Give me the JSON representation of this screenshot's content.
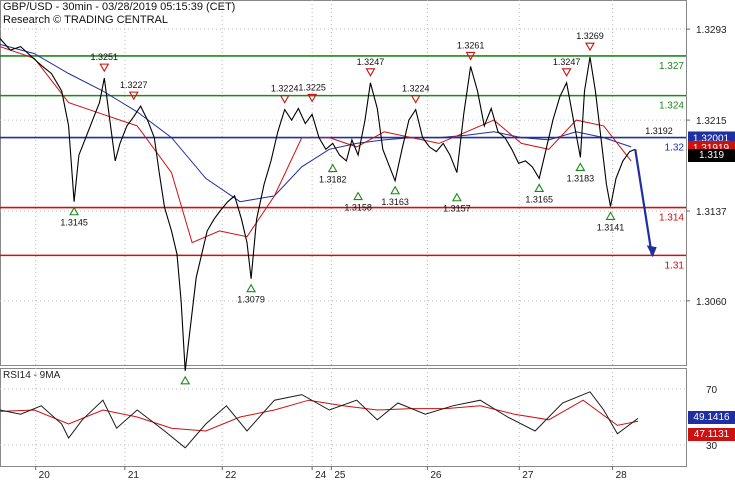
{
  "header": {
    "title": "GBP/USD - 30min - 03/28/2019 05:15:39 (CET)",
    "source": "Research © TRADING CENTRAL"
  },
  "rsi_panel": {
    "label": "RSI14 - 9MA",
    "axis_ticks": [
      70,
      30
    ],
    "rsi_value": "49.1416",
    "ma_value": "47.1131"
  },
  "price_axis": {
    "ticks": [
      "1.3293",
      "1.3215",
      "1.3137",
      "1.3060"
    ],
    "current_price": "1.319",
    "badges": [
      {
        "text": "1.32001",
        "bg": "#1f2fa0",
        "fg": "#ffffff",
        "price": 1.32001
      },
      {
        "text": "1.31919",
        "bg": "#cc1111",
        "fg": "#ffffff",
        "price": 1.3192
      }
    ]
  },
  "x_axis": {
    "labels": [
      "20",
      "21",
      "22",
      "24",
      "25",
      "26",
      "27",
      "28"
    ],
    "label_frac": [
      0.052,
      0.182,
      0.324,
      0.455,
      0.483,
      0.623,
      0.757,
      0.893
    ]
  },
  "colors": {
    "resistance": "#1a8a1a",
    "pivot": "#1f2fa0",
    "support": "#cc1111",
    "price": "#000000",
    "ma_fast": "#cc1111",
    "ma_slow": "#1f2fa0",
    "forecast": "#1f2fa0"
  },
  "chart_data": {
    "type": "line",
    "title": "GBP/USD - 30min - 03/28/2019 05:15:39 (CET)",
    "ylim": [
      1.3005,
      1.3318
    ],
    "levels": [
      {
        "label": "1.327",
        "value": 1.327,
        "kind": "resistance"
      },
      {
        "label": "1.324",
        "value": 1.3236,
        "kind": "resistance"
      },
      {
        "label": "1.32",
        "value": 1.32,
        "kind": "pivot"
      },
      {
        "label": "1.314",
        "value": 1.314,
        "kind": "support"
      },
      {
        "label": "1.31",
        "value": 1.3099,
        "kind": "support"
      }
    ],
    "price_points": [
      [
        0.0,
        1.3285
      ],
      [
        0.015,
        1.3275
      ],
      [
        0.03,
        1.3278
      ],
      [
        0.045,
        1.327
      ],
      [
        0.06,
        1.3262
      ],
      [
        0.075,
        1.3255
      ],
      [
        0.09,
        1.324
      ],
      [
        0.1,
        1.321
      ],
      [
        0.108,
        1.3145
      ],
      [
        0.115,
        1.3185
      ],
      [
        0.125,
        1.32
      ],
      [
        0.135,
        1.3215
      ],
      [
        0.145,
        1.323
      ],
      [
        0.152,
        1.3251
      ],
      [
        0.16,
        1.3215
      ],
      [
        0.168,
        1.318
      ],
      [
        0.175,
        1.3195
      ],
      [
        0.185,
        1.321
      ],
      [
        0.195,
        1.3218
      ],
      [
        0.205,
        1.3227
      ],
      [
        0.215,
        1.3215
      ],
      [
        0.225,
        1.32
      ],
      [
        0.232,
        1.317
      ],
      [
        0.24,
        1.314
      ],
      [
        0.25,
        1.312
      ],
      [
        0.258,
        1.31
      ],
      [
        0.264,
        1.306
      ],
      [
        0.27,
        1.3
      ],
      [
        0.278,
        1.304
      ],
      [
        0.286,
        1.308
      ],
      [
        0.294,
        1.31
      ],
      [
        0.302,
        1.312
      ],
      [
        0.312,
        1.313
      ],
      [
        0.322,
        1.3138
      ],
      [
        0.332,
        1.3145
      ],
      [
        0.342,
        1.315
      ],
      [
        0.352,
        1.313
      ],
      [
        0.36,
        1.311
      ],
      [
        0.366,
        1.3079
      ],
      [
        0.374,
        1.313
      ],
      [
        0.385,
        1.316
      ],
      [
        0.395,
        1.318
      ],
      [
        0.405,
        1.3205
      ],
      [
        0.415,
        1.3224
      ],
      [
        0.425,
        1.3215
      ],
      [
        0.435,
        1.3225
      ],
      [
        0.445,
        1.3212
      ],
      [
        0.455,
        1.322
      ],
      [
        0.465,
        1.32
      ],
      [
        0.475,
        1.319
      ],
      [
        0.485,
        1.3195
      ],
      [
        0.495,
        1.3185
      ],
      [
        0.505,
        1.318
      ],
      [
        0.513,
        1.3198
      ],
      [
        0.522,
        1.3185
      ],
      [
        0.532,
        1.3215
      ],
      [
        0.54,
        1.3247
      ],
      [
        0.55,
        1.3225
      ],
      [
        0.558,
        1.319
      ],
      [
        0.568,
        1.3175
      ],
      [
        0.576,
        1.3163
      ],
      [
        0.586,
        1.319
      ],
      [
        0.596,
        1.3215
      ],
      [
        0.606,
        1.3224
      ],
      [
        0.616,
        1.32
      ],
      [
        0.626,
        1.3192
      ],
      [
        0.636,
        1.3188
      ],
      [
        0.646,
        1.3195
      ],
      [
        0.656,
        1.3185
      ],
      [
        0.666,
        1.317
      ],
      [
        0.676,
        1.322
      ],
      [
        0.686,
        1.3261
      ],
      [
        0.696,
        1.324
      ],
      [
        0.706,
        1.321
      ],
      [
        0.716,
        1.3225
      ],
      [
        0.726,
        1.3205
      ],
      [
        0.736,
        1.32
      ],
      [
        0.746,
        1.319
      ],
      [
        0.756,
        1.3178
      ],
      [
        0.766,
        1.318
      ],
      [
        0.776,
        1.3175
      ],
      [
        0.786,
        1.3165
      ],
      [
        0.796,
        1.319
      ],
      [
        0.806,
        1.3215
      ],
      [
        0.816,
        1.3235
      ],
      [
        0.826,
        1.3247
      ],
      [
        0.836,
        1.3215
      ],
      [
        0.846,
        1.3183
      ],
      [
        0.852,
        1.324
      ],
      [
        0.86,
        1.3269
      ],
      [
        0.868,
        1.324
      ],
      [
        0.876,
        1.32
      ],
      [
        0.884,
        1.316
      ],
      [
        0.89,
        1.3141
      ],
      [
        0.898,
        1.3165
      ],
      [
        0.908,
        1.318
      ],
      [
        0.918,
        1.3188
      ],
      [
        0.926,
        1.319
      ]
    ],
    "ma_fast_points": [
      [
        0.0,
        1.3278
      ],
      [
        0.05,
        1.3268
      ],
      [
        0.1,
        1.323
      ],
      [
        0.15,
        1.322
      ],
      [
        0.2,
        1.321
      ],
      [
        0.25,
        1.317
      ],
      [
        0.28,
        1.311
      ],
      [
        0.32,
        1.312
      ],
      [
        0.36,
        1.3115
      ],
      [
        0.4,
        1.315
      ],
      [
        0.44,
        1.32
      ],
      [
        0.48,
        1.32
      ],
      [
        0.52,
        1.3192
      ],
      [
        0.56,
        1.3205
      ],
      [
        0.6,
        1.32
      ],
      [
        0.64,
        1.3195
      ],
      [
        0.68,
        1.3205
      ],
      [
        0.72,
        1.3215
      ],
      [
        0.76,
        1.3195
      ],
      [
        0.8,
        1.319
      ],
      [
        0.84,
        1.3215
      ],
      [
        0.88,
        1.321
      ],
      [
        0.92,
        1.318
      ]
    ],
    "ma_slow_points": [
      [
        0.0,
        1.328
      ],
      [
        0.05,
        1.3272
      ],
      [
        0.1,
        1.3255
      ],
      [
        0.15,
        1.324
      ],
      [
        0.2,
        1.3222
      ],
      [
        0.25,
        1.32
      ],
      [
        0.3,
        1.3165
      ],
      [
        0.35,
        1.3145
      ],
      [
        0.4,
        1.315
      ],
      [
        0.44,
        1.3175
      ],
      [
        0.48,
        1.319
      ],
      [
        0.52,
        1.3195
      ],
      [
        0.56,
        1.3198
      ],
      [
        0.6,
        1.32
      ],
      [
        0.64,
        1.32
      ],
      [
        0.68,
        1.3202
      ],
      [
        0.72,
        1.3205
      ],
      [
        0.76,
        1.32
      ],
      [
        0.8,
        1.3198
      ],
      [
        0.84,
        1.3205
      ],
      [
        0.88,
        1.32
      ],
      [
        0.92,
        1.3192
      ]
    ],
    "forecast": [
      [
        0.926,
        1.319
      ],
      [
        0.95,
        1.31
      ]
    ],
    "annotations": [
      {
        "x": 0.108,
        "y": 1.3145,
        "label": "1.3145",
        "kind": "low"
      },
      {
        "x": 0.152,
        "y": 1.3251,
        "label": "1.3251",
        "kind": "high"
      },
      {
        "x": 0.195,
        "y": 1.3227,
        "label": "1.3227",
        "kind": "high"
      },
      {
        "x": 0.27,
        "y": 1.3,
        "label": "",
        "kind": "low"
      },
      {
        "x": 0.366,
        "y": 1.3079,
        "label": "1.3079",
        "kind": "low"
      },
      {
        "x": 0.415,
        "y": 1.3224,
        "label": "1.3224",
        "kind": "high"
      },
      {
        "x": 0.455,
        "y": 1.3225,
        "label": "1.3225",
        "kind": "high"
      },
      {
        "x": 0.485,
        "y": 1.3182,
        "label": "1.3182",
        "kind": "low"
      },
      {
        "x": 0.522,
        "y": 1.3158,
        "label": "1.3158",
        "kind": "low"
      },
      {
        "x": 0.54,
        "y": 1.3247,
        "label": "1.3247",
        "kind": "high"
      },
      {
        "x": 0.576,
        "y": 1.3163,
        "label": "1.3163",
        "kind": "low"
      },
      {
        "x": 0.606,
        "y": 1.3224,
        "label": "1.3224",
        "kind": "high"
      },
      {
        "x": 0.666,
        "y": 1.3157,
        "label": "1.3157",
        "kind": "low"
      },
      {
        "x": 0.686,
        "y": 1.3261,
        "label": "1.3261",
        "kind": "high"
      },
      {
        "x": 0.786,
        "y": 1.3165,
        "label": "1.3165",
        "kind": "low"
      },
      {
        "x": 0.826,
        "y": 1.3247,
        "label": "1.3247",
        "kind": "high"
      },
      {
        "x": 0.846,
        "y": 1.3183,
        "label": "1.3183",
        "kind": "low"
      },
      {
        "x": 0.86,
        "y": 1.3269,
        "label": "1.3269",
        "kind": "high"
      },
      {
        "x": 0.89,
        "y": 1.3141,
        "label": "1.3141",
        "kind": "low"
      },
      {
        "x": 0.926,
        "y": 1.3192,
        "label": "1.3192",
        "kind": "note"
      }
    ],
    "rsi": {
      "ylim": [
        15,
        85
      ],
      "rsi_points": [
        [
          0.0,
          55
        ],
        [
          0.03,
          52
        ],
        [
          0.06,
          58
        ],
        [
          0.09,
          45
        ],
        [
          0.1,
          35
        ],
        [
          0.12,
          48
        ],
        [
          0.15,
          62
        ],
        [
          0.17,
          42
        ],
        [
          0.2,
          55
        ],
        [
          0.24,
          40
        ],
        [
          0.27,
          28
        ],
        [
          0.3,
          45
        ],
        [
          0.33,
          58
        ],
        [
          0.36,
          40
        ],
        [
          0.4,
          62
        ],
        [
          0.44,
          66
        ],
        [
          0.48,
          55
        ],
        [
          0.52,
          62
        ],
        [
          0.55,
          48
        ],
        [
          0.58,
          60
        ],
        [
          0.62,
          52
        ],
        [
          0.66,
          58
        ],
        [
          0.7,
          62
        ],
        [
          0.74,
          50
        ],
        [
          0.78,
          40
        ],
        [
          0.82,
          60
        ],
        [
          0.86,
          68
        ],
        [
          0.88,
          55
        ],
        [
          0.9,
          38
        ],
        [
          0.93,
          49
        ]
      ],
      "ma_points": [
        [
          0.0,
          54
        ],
        [
          0.05,
          55
        ],
        [
          0.1,
          45
        ],
        [
          0.15,
          55
        ],
        [
          0.2,
          50
        ],
        [
          0.25,
          42
        ],
        [
          0.3,
          40
        ],
        [
          0.35,
          50
        ],
        [
          0.4,
          55
        ],
        [
          0.45,
          62
        ],
        [
          0.5,
          58
        ],
        [
          0.55,
          55
        ],
        [
          0.6,
          56
        ],
        [
          0.65,
          56
        ],
        [
          0.7,
          58
        ],
        [
          0.75,
          52
        ],
        [
          0.8,
          48
        ],
        [
          0.85,
          62
        ],
        [
          0.9,
          44
        ],
        [
          0.93,
          47
        ]
      ]
    }
  }
}
